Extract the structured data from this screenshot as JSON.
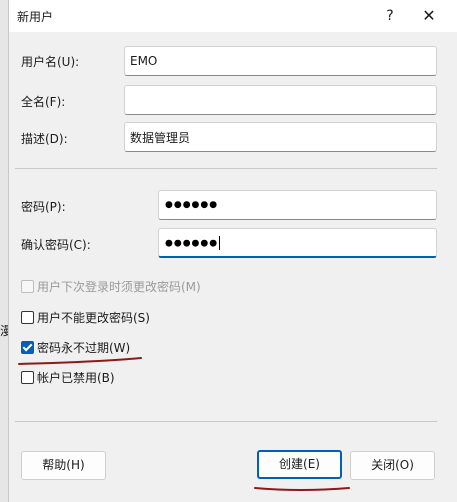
{
  "window": {
    "title": "新用户"
  },
  "edge_fragment": "漫",
  "form": {
    "username_label": "用户名(U):",
    "username_value": "EMO",
    "fullname_label": "全名(F):",
    "fullname_value": "",
    "description_label": "描述(D):",
    "description_value": "数据管理员",
    "password_label": "密码(P):",
    "password_dots": "●●●●●●",
    "confirm_label": "确认密码(C):",
    "confirm_dots": "●●●●●●"
  },
  "options": [
    {
      "label": "用户下次登录时须更改密码(M)",
      "checked": false,
      "disabled": true
    },
    {
      "label": "用户不能更改密码(S)",
      "checked": false,
      "disabled": false
    },
    {
      "label": "密码永不过期(W)",
      "checked": true,
      "disabled": false
    },
    {
      "label": "帐户已禁用(B)",
      "checked": false,
      "disabled": false
    }
  ],
  "buttons": {
    "help": "帮助(H)",
    "create": "创建(E)",
    "close": "关闭(O)"
  },
  "colors": {
    "accent": "#005fb8",
    "annotation": "#8b1a1a"
  }
}
